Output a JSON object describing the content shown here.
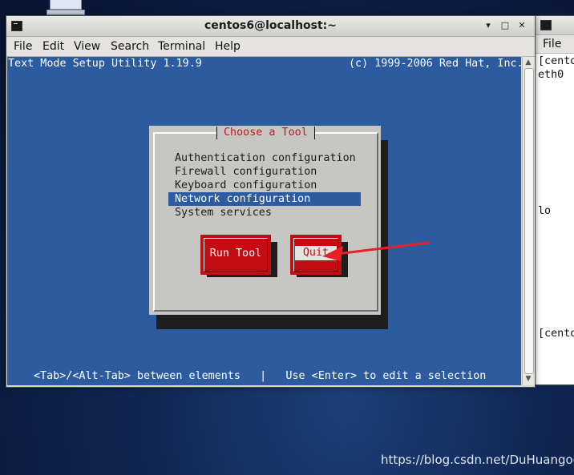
{
  "desktop": {
    "watermark": "https://blog.csdn.net/DuHuangod"
  },
  "main_window": {
    "title": "centos6@localhost:~",
    "controls": {
      "minimize": "▾",
      "maximize": "□",
      "close": "✕"
    },
    "menu": [
      "File",
      "Edit",
      "View",
      "Search",
      "Terminal",
      "Help"
    ]
  },
  "terminal": {
    "header_left": "Text Mode Setup Utility 1.19.9",
    "header_right": "(c) 1999-2006 Red Hat, Inc.",
    "status_line": "<Tab>/<Alt-Tab> between elements   |   Use <Enter> to edit a selection"
  },
  "dialog": {
    "title": "Choose a Tool",
    "items": [
      "Authentication configuration",
      "Firewall configuration",
      "Keyboard configuration",
      "Network configuration",
      "System services"
    ],
    "selected_index": 3,
    "run_tool_label": "Run Tool",
    "quit_label": "Quit"
  },
  "second_window": {
    "menu_file": "File",
    "lines": [
      "[cento",
      "eth0",
      "lo",
      "[cento"
    ]
  },
  "colors": {
    "terminal_bg": "#2d5b9f",
    "dialog_bg": "#c6c6c3",
    "dialog_title": "#c3161b",
    "button_red": "#c40d12",
    "annotation_arrow": "#e8202a"
  }
}
